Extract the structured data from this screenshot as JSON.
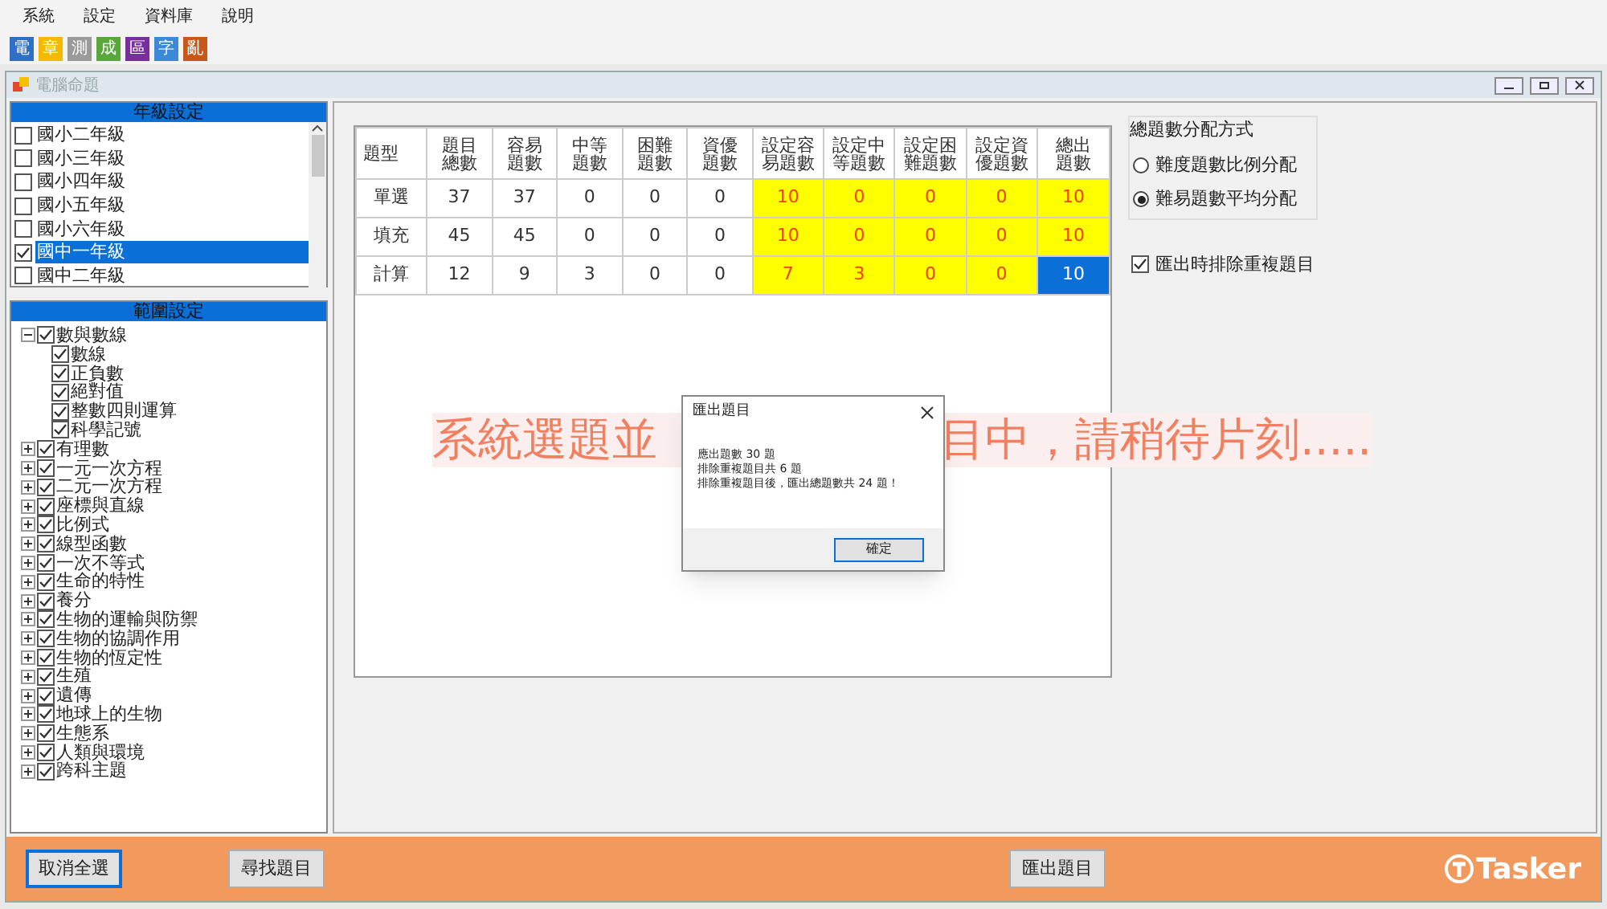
{
  "menu": [
    "系統",
    "設定",
    "資料庫",
    "說明"
  ],
  "toolbar": [
    {
      "label": "電",
      "color": "#2f6fc4"
    },
    {
      "label": "章",
      "color": "#f5b800"
    },
    {
      "label": "測",
      "color": "#9a9a9a"
    },
    {
      "label": "成",
      "color": "#5aa83c"
    },
    {
      "label": "區",
      "color": "#7a2f9e"
    },
    {
      "label": "字",
      "color": "#3a8ad8"
    },
    {
      "label": "亂",
      "color": "#c8581a"
    }
  ],
  "window": {
    "title": "電腦命題"
  },
  "grade_panel": {
    "title": "年級設定",
    "items": [
      {
        "label": "國小二年級",
        "checked": false,
        "selected": false
      },
      {
        "label": "國小三年級",
        "checked": false,
        "selected": false
      },
      {
        "label": "國小四年級",
        "checked": false,
        "selected": false
      },
      {
        "label": "國小五年級",
        "checked": false,
        "selected": false
      },
      {
        "label": "國小六年級",
        "checked": false,
        "selected": false
      },
      {
        "label": "國中一年級",
        "checked": true,
        "selected": true
      },
      {
        "label": "國中二年級",
        "checked": false,
        "selected": false
      }
    ]
  },
  "range_panel": {
    "title": "範圍設定",
    "tree": [
      {
        "label": "數與數線",
        "checked": true,
        "expanded": true,
        "children": [
          {
            "label": "數線",
            "checked": true
          },
          {
            "label": "正負數",
            "checked": true
          },
          {
            "label": "絕對值",
            "checked": true
          },
          {
            "label": "整數四則運算",
            "checked": true
          },
          {
            "label": "科學記號",
            "checked": true
          }
        ]
      },
      {
        "label": "有理數",
        "checked": true,
        "expanded": false
      },
      {
        "label": "一元一次方程",
        "checked": true,
        "expanded": false
      },
      {
        "label": "二元一次方程",
        "checked": true,
        "expanded": false
      },
      {
        "label": "座標與直線",
        "checked": true,
        "expanded": false
      },
      {
        "label": "比例式",
        "checked": true,
        "expanded": false
      },
      {
        "label": "線型函數",
        "checked": true,
        "expanded": false
      },
      {
        "label": "一次不等式",
        "checked": true,
        "expanded": false
      },
      {
        "label": "生命的特性",
        "checked": true,
        "expanded": false
      },
      {
        "label": "養分",
        "checked": true,
        "expanded": false
      },
      {
        "label": "生物的運輸與防禦",
        "checked": true,
        "expanded": false
      },
      {
        "label": "生物的協調作用",
        "checked": true,
        "expanded": false
      },
      {
        "label": "生物的恆定性",
        "checked": true,
        "expanded": false
      },
      {
        "label": "生殖",
        "checked": true,
        "expanded": false
      },
      {
        "label": "遺傳",
        "checked": true,
        "expanded": false
      },
      {
        "label": "地球上的生物",
        "checked": true,
        "expanded": false
      },
      {
        "label": "生態系",
        "checked": true,
        "expanded": false
      },
      {
        "label": "人類與環境",
        "checked": true,
        "expanded": false
      },
      {
        "label": "跨科主題",
        "checked": true,
        "expanded": false
      }
    ]
  },
  "table": {
    "columns": [
      {
        "label": "題型",
        "highlighted": false
      },
      {
        "label": "題目總數",
        "highlighted": false
      },
      {
        "label": "容易題數",
        "highlighted": false
      },
      {
        "label": "中等題數",
        "highlighted": false
      },
      {
        "label": "困難題數",
        "highlighted": false
      },
      {
        "label": "資優題數",
        "highlighted": false
      },
      {
        "label": "設定容易題數",
        "highlighted": true
      },
      {
        "label": "設定中等題數",
        "highlighted": true
      },
      {
        "label": "設定困難題數",
        "highlighted": true
      },
      {
        "label": "設定資優題數",
        "highlighted": true
      },
      {
        "label": "總出題數",
        "highlighted": true
      }
    ],
    "rows": [
      {
        "cells": [
          {
            "text": "單選",
            "selected": false
          },
          {
            "text": "37",
            "selected": false
          },
          {
            "text": "37",
            "selected": false
          },
          {
            "text": "0",
            "selected": false
          },
          {
            "text": "0",
            "selected": false
          },
          {
            "text": "0",
            "selected": false
          },
          {
            "text": "10",
            "selected": false
          },
          {
            "text": "0",
            "selected": false
          },
          {
            "text": "0",
            "selected": false
          },
          {
            "text": "0",
            "selected": false
          },
          {
            "text": "10",
            "selected": false
          }
        ]
      },
      {
        "cells": [
          {
            "text": "填充",
            "selected": false
          },
          {
            "text": "45",
            "selected": false
          },
          {
            "text": "45",
            "selected": false
          },
          {
            "text": "0",
            "selected": false
          },
          {
            "text": "0",
            "selected": false
          },
          {
            "text": "0",
            "selected": false
          },
          {
            "text": "10",
            "selected": false
          },
          {
            "text": "0",
            "selected": false
          },
          {
            "text": "0",
            "selected": false
          },
          {
            "text": "0",
            "selected": false
          },
          {
            "text": "10",
            "selected": false
          }
        ]
      },
      {
        "cells": [
          {
            "text": "計算",
            "selected": false
          },
          {
            "text": "12",
            "selected": false
          },
          {
            "text": "9",
            "selected": false
          },
          {
            "text": "3",
            "selected": false
          },
          {
            "text": "0",
            "selected": false
          },
          {
            "text": "0",
            "selected": false
          },
          {
            "text": "7",
            "selected": false
          },
          {
            "text": "3",
            "selected": false
          },
          {
            "text": "0",
            "selected": false
          },
          {
            "text": "0",
            "selected": false
          },
          {
            "text": "10",
            "selected": true
          }
        ]
      }
    ]
  },
  "distribution": {
    "title": "總題數分配方式",
    "options": [
      {
        "label": "難度題數比例分配",
        "selected": false
      },
      {
        "label": "難易題數平均分配",
        "selected": true
      }
    ]
  },
  "exclude_duplicates": {
    "label": "匯出時排除重複題目",
    "checked": true
  },
  "overlay_message": {
    "before": "系統選題並",
    "after": "目中，請稍待片刻....."
  },
  "dialog": {
    "title": "匯出題目",
    "lines": [
      "應出題數 30 題",
      "排除重複題目共 6 題",
      "排除重複題目後，匯出總題數共 24 題！"
    ],
    "button": "確定"
  },
  "bottom_buttons": [
    {
      "label": "取消全選",
      "focused": true
    },
    {
      "label": "尋找題目",
      "focused": false
    },
    {
      "label": "匯出題目",
      "focused": false
    }
  ],
  "logo": "Tasker"
}
